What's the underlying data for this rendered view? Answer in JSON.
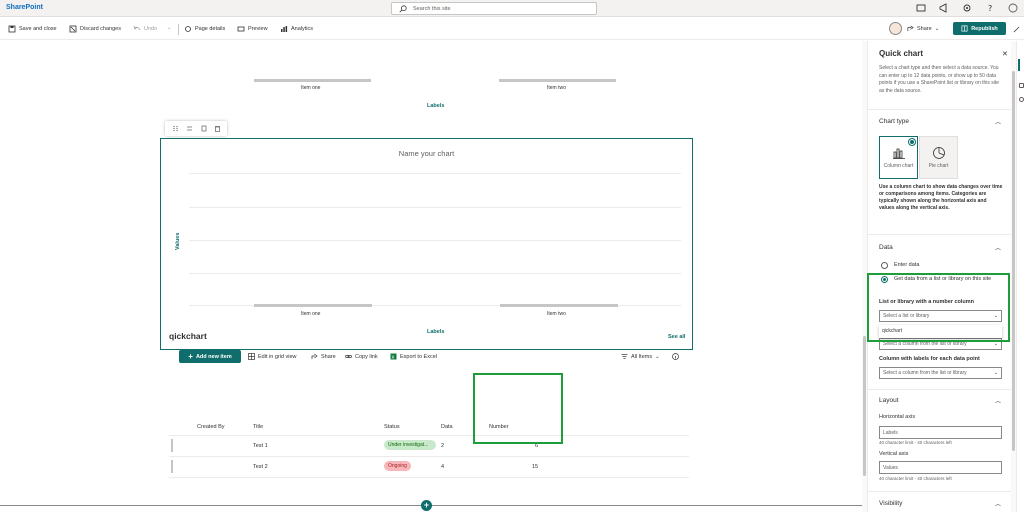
{
  "suite": {
    "brand": "SharePoint",
    "search_placeholder": "Search this site"
  },
  "command_bar": {
    "save_close": "Save and close",
    "discard": "Discard changes",
    "undo": "Undo",
    "page_details": "Page details",
    "preview": "Preview",
    "analytics": "Analytics",
    "share": "Share",
    "republish": "Republish"
  },
  "chart_prev": {
    "categories": [
      "Item one",
      "Item two"
    ],
    "xlabel": "Labels"
  },
  "chart_main": {
    "title": "Name your chart",
    "ylabel": "Values",
    "xlabel": "Labels",
    "categories": [
      "Item one",
      "Item two"
    ]
  },
  "list": {
    "title": "qickchart",
    "see_all": "See all",
    "add_new": "Add new item",
    "edit_grid": "Edit in grid view",
    "share": "Share",
    "copy_link": "Copy link",
    "export": "Export to Excel",
    "view": "All Items",
    "columns": [
      "Created By",
      "Title",
      "Status",
      "Data",
      "Number"
    ],
    "rows": [
      {
        "title": "Test 1",
        "status": "Under investigat...",
        "status_color": "green",
        "data": "2",
        "number": "6"
      },
      {
        "title": "Test 2",
        "status": "Ongoing",
        "status_color": "red",
        "data": "4",
        "number": "15"
      }
    ]
  },
  "pane": {
    "title": "Quick chart",
    "description": "Select a chart type and then select a data source. You can enter up to 12 data points, or show up to 50 data points if you use a SharePoint list or library on this site as the data source.",
    "chart_type_section": "Chart type",
    "chart_types": [
      {
        "label": "Column chart",
        "icon": "column-chart-icon",
        "selected": true
      },
      {
        "label": "Pie chart",
        "icon": "pie-chart-icon",
        "selected": false
      }
    ],
    "type_description": "Use a column chart to show data changes over time or comparisons among items. Categories are typically shown along the horizontal axis and values along the vertical axis.",
    "data_section": "Data",
    "radio_enter": "Enter data",
    "radio_list": "Get data from a list or library on this site",
    "list_field_label": "List or library with a number column",
    "list_placeholder": "Select a list or library",
    "list_option": "qickchart",
    "column_placeholder": "Select a column from the list or library",
    "labels_field_label": "Column with labels for each data point",
    "labels_placeholder": "Select a column from the list or library",
    "layout_section": "Layout",
    "haxis_label": "Horizontal axis",
    "haxis_value": "Labels",
    "haxis_hint": "40 character limit - 40 characters left",
    "vaxis_label": "Vertical axis",
    "vaxis_value": "Values",
    "vaxis_hint": "40 character limit - 40 characters left",
    "visibility_section": "Visibility"
  },
  "colors": {
    "accent": "#0f6e6b",
    "highlight": "#1e9e3a"
  }
}
